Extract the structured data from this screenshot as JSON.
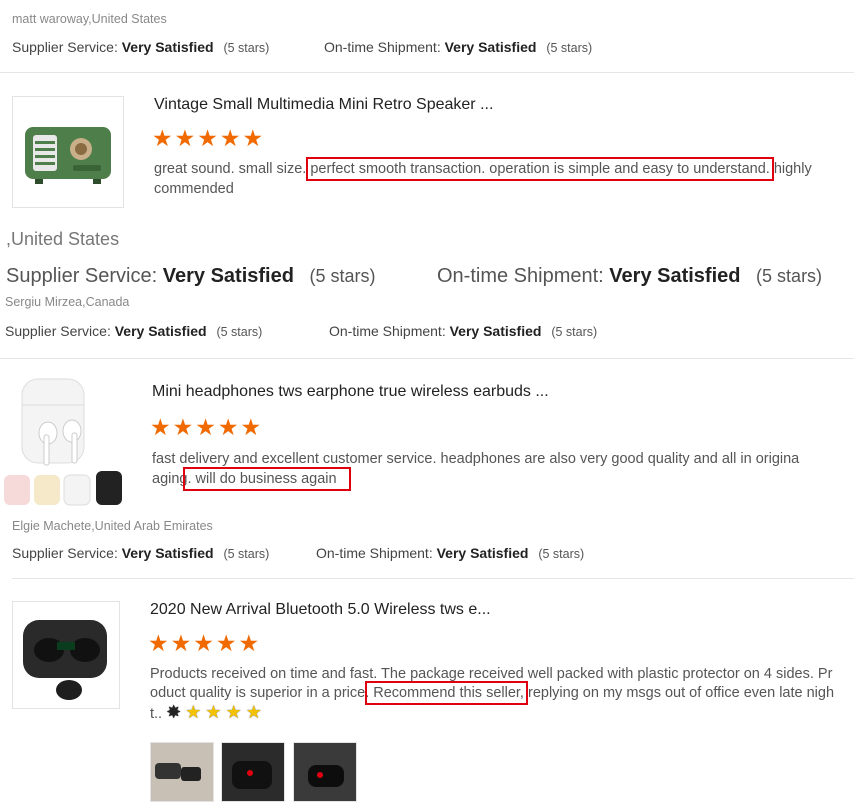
{
  "review1": {
    "reviewer": "matt waroway,United States",
    "supplier_label": "Supplier Service:",
    "supplier_value": "Very Satisfied",
    "supplier_stars": "(5 stars)",
    "shipment_label": "On-time Shipment:",
    "shipment_value": "Very Satisfied",
    "shipment_stars": "(5 stars)"
  },
  "product1": {
    "title": "Vintage Small Multimedia Mini Retro Speaker ...",
    "rating": 5,
    "comment_pre": "great sound. small size. ",
    "comment_highlight": "perfect smooth transaction.  operation is simple and easy to understand.",
    "comment_post": " highly",
    "comment_line2": "commended"
  },
  "zoom": {
    "location": ",United States",
    "supplier_label": "Supplier Service:",
    "supplier_value": "Very Satisfied",
    "supplier_stars": "(5 stars)",
    "shipment_label": "On-time Shipment:",
    "shipment_value": "Very Satisfied",
    "shipment_stars": "(5 stars)"
  },
  "review2": {
    "reviewer": "Sergiu Mirzea,Canada",
    "supplier_label": "Supplier Service:",
    "supplier_value": "Very Satisfied",
    "supplier_stars": "(5 stars)",
    "shipment_label": "On-time Shipment:",
    "shipment_value": "Very Satisfied",
    "shipment_stars": "(5 stars)"
  },
  "product2": {
    "title": "Mini headphones tws earphone true wireless earbuds ...",
    "rating": 5,
    "comment_line1": "fast delivery and excellent customer service. headphones are also very good quality and all in origina",
    "comment_pre2": "aging",
    "comment_highlight": ". will do business again"
  },
  "review3": {
    "reviewer": "Elgie Machete,United Arab Emirates",
    "supplier_label": "Supplier Service:",
    "supplier_value": "Very Satisfied",
    "supplier_stars": "(5 stars)",
    "shipment_label": "On-time Shipment:",
    "shipment_value": "Very Satisfied",
    "shipment_stars": "(5 stars)"
  },
  "product3": {
    "title": "2020 New Arrival Bluetooth 5.0 Wireless tws e...",
    "rating": 5,
    "comment_line1": "Products received on time and fast. The package received well packed with plastic protector on 4 sides. Pr",
    "comment_pre2": "oduct quality is superior in a price.",
    "comment_highlight": " Recommend this seller,",
    "comment_post2": " replying on my msgs out of office even late nigh",
    "comment_line3": "t.."
  },
  "icons": {
    "star": "★",
    "emoji_star": "✸"
  },
  "colors": {
    "star_orange": "#f06a00",
    "highlight_red": "#e0000f",
    "emoji_yellow": "#f2c200"
  }
}
